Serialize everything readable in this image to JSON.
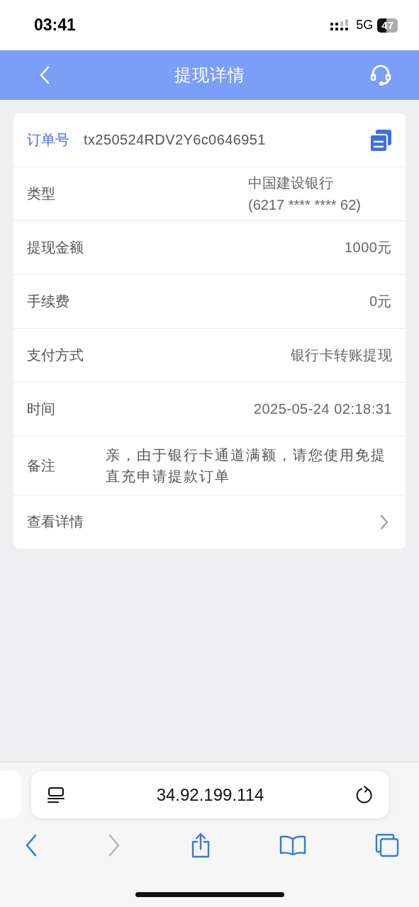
{
  "status_bar": {
    "time": "03:41",
    "network": "5G",
    "battery": "47"
  },
  "header": {
    "title": "提现详情"
  },
  "order": {
    "label": "订单号",
    "value": "tx250524RDV2Y6c0646951"
  },
  "rows": [
    {
      "kind": "lines",
      "label": "类型",
      "lines": [
        "中国建设银行",
        "(6217 **** **** 62)"
      ]
    },
    {
      "kind": "value",
      "label": "提现金额",
      "value": "1000元"
    },
    {
      "kind": "value",
      "label": "手续费",
      "value": "0元"
    },
    {
      "kind": "value",
      "label": "支付方式",
      "value": "银行卡转账提现"
    },
    {
      "kind": "value",
      "label": "时间",
      "value": "2025-05-24 02:18:31"
    },
    {
      "kind": "note",
      "label": "备注",
      "value": "亲，由于银行卡通道满额，请您使用免提直充申请提款订单"
    },
    {
      "kind": "link",
      "label": "查看详情"
    }
  ],
  "browser": {
    "url": "34.92.199.114",
    "back_disabled": false,
    "forward_disabled": true
  }
}
